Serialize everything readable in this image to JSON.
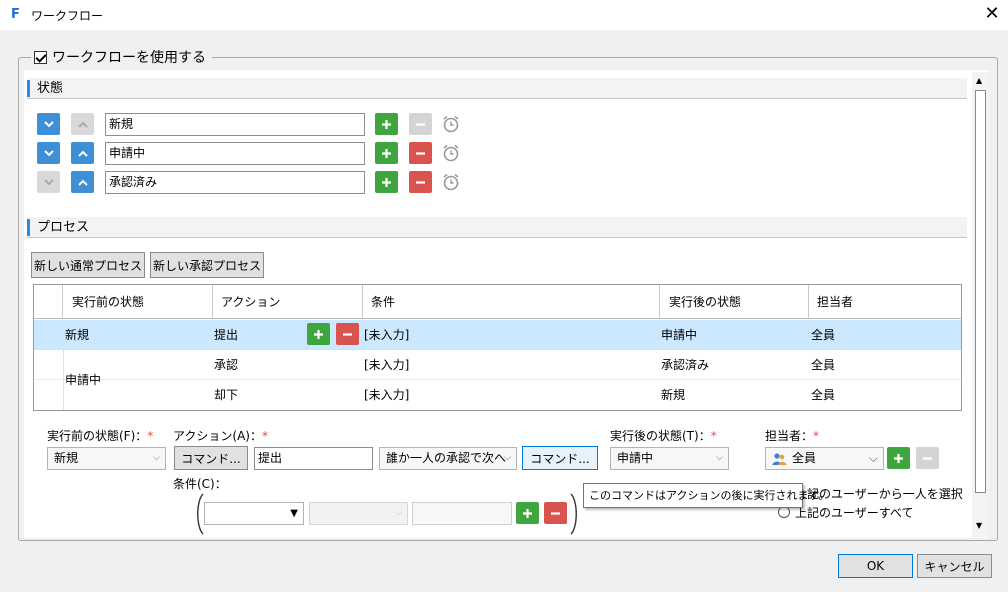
{
  "window": {
    "title": "ワークフロー",
    "app_icon": "F"
  },
  "use_workflow": {
    "label": "ワークフローを使用する",
    "checked": true
  },
  "states": {
    "heading": "状態",
    "items": [
      {
        "name": "新規"
      },
      {
        "name": "申請中"
      },
      {
        "name": "承認済み"
      }
    ]
  },
  "process": {
    "heading": "プロセス",
    "new_normal_button": "新しい通常プロセス",
    "new_approval_button": "新しい承認プロセス",
    "columns": [
      "実行前の状態",
      "アクション",
      "条件",
      "実行後の状態",
      "担当者"
    ],
    "rows": [
      {
        "before": "新規",
        "action": "提出",
        "condition": "[未入力]",
        "after": "申請中",
        "assignee": "全員"
      },
      {
        "before": "申請中",
        "action": "承認",
        "condition": "[未入力]",
        "after": "承認済み",
        "assignee": "全員"
      },
      {
        "before": "",
        "action": "却下",
        "condition": "[未入力]",
        "after": "新規",
        "assignee": "全員"
      }
    ]
  },
  "editor": {
    "before_label": "実行前の状態(F)：",
    "before_value": "新規",
    "action_label": "アクション(A)：",
    "command_button": "コマンド...",
    "action_value": "提出",
    "approval_mode": "誰か一人の承認で次へ",
    "command_button2": "コマンド...",
    "after_label": "実行後の状態(T)：",
    "after_value": "申請中",
    "assignee_label": "担当者：",
    "assignee_value": "全員",
    "condition_label": "条件(C)：",
    "required_mark": "*",
    "radio_one": "上記のユーザーから一人を選択",
    "radio_all": "上記のユーザーすべて"
  },
  "tooltip": "このコマンドはアクションの後に実行されます。",
  "footer": {
    "ok": "OK",
    "cancel": "キャンセル"
  },
  "colors": {
    "accent_blue": "#3d8fd6",
    "green": "#3fa63f",
    "red": "#d9534f",
    "selection": "#cce8ff"
  }
}
